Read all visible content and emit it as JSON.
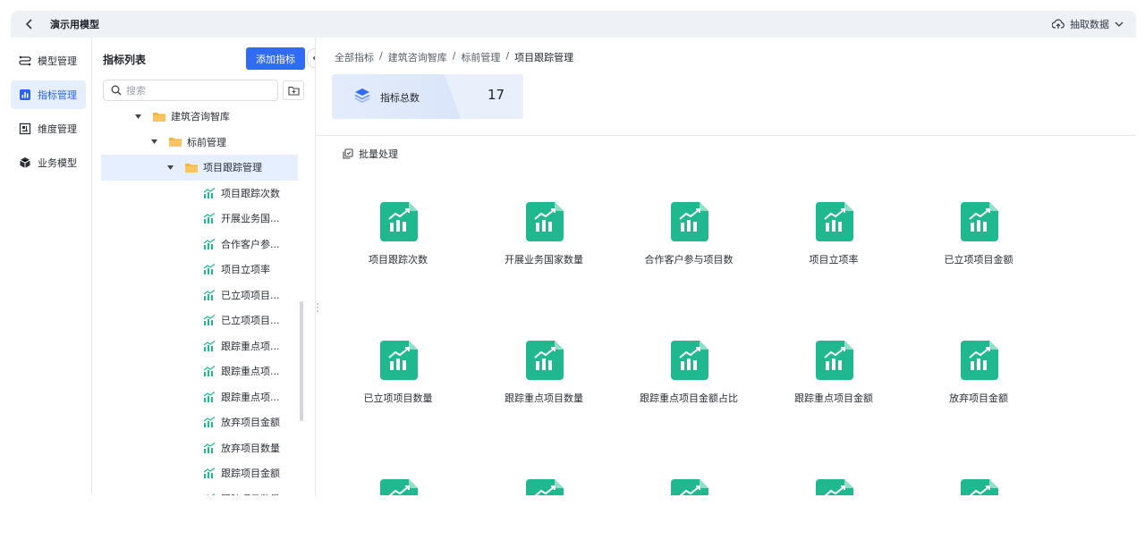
{
  "header": {
    "title": "演示用模型",
    "extract_label": "抽取数据"
  },
  "nav": [
    {
      "label": "模型管理",
      "icon": "model-flow-icon",
      "active": false
    },
    {
      "label": "指标管理",
      "icon": "bar-chart-icon",
      "active": true
    },
    {
      "label": "维度管理",
      "icon": "dimension-icon",
      "active": false
    },
    {
      "label": "业务模型",
      "icon": "cube-icon",
      "active": false
    }
  ],
  "list_panel": {
    "title": "指标列表",
    "add_label": "添加指标",
    "search_placeholder": "搜索",
    "tree": [
      {
        "label": "建筑咨询智库",
        "type": "folder",
        "level": 1
      },
      {
        "label": "标前管理",
        "type": "folder",
        "level": 2
      },
      {
        "label": "项目跟踪管理",
        "type": "folder",
        "level": 3,
        "selected": true
      },
      {
        "label": "项目跟踪次数",
        "type": "metric"
      },
      {
        "label": "开展业务国...",
        "type": "metric"
      },
      {
        "label": "合作客户参...",
        "type": "metric"
      },
      {
        "label": "项目立项率",
        "type": "metric"
      },
      {
        "label": "已立项项目...",
        "type": "metric"
      },
      {
        "label": "已立项项目...",
        "type": "metric"
      },
      {
        "label": "跟踪重点项...",
        "type": "metric"
      },
      {
        "label": "跟踪重点项...",
        "type": "metric"
      },
      {
        "label": "跟踪重点项...",
        "type": "metric"
      },
      {
        "label": "放弃项目金额",
        "type": "metric"
      },
      {
        "label": "放弃项目数量",
        "type": "metric"
      },
      {
        "label": "跟踪项目金额",
        "type": "metric"
      },
      {
        "label": "跟踪项目数量",
        "type": "metric"
      }
    ]
  },
  "breadcrumb": [
    "全部指标",
    "建筑咨询智库",
    "标前管理",
    "项目跟踪管理"
  ],
  "summary": {
    "label": "指标总数",
    "count": "17"
  },
  "batch_label": "批量处理",
  "metrics": [
    "项目跟踪次数",
    "开展业务国家数量",
    "合作客户参与项目数",
    "项目立项率",
    "已立项项目金额",
    "已立项项目数量",
    "跟踪重点项目数量",
    "跟踪重点项目金额占比",
    "跟踪重点项目金额",
    "放弃项目金额",
    "",
    "",
    "",
    "",
    ""
  ],
  "colors": {
    "accent": "#2f6bf3",
    "metric_green": "#1fb88f",
    "folder": "#f5b53f"
  }
}
